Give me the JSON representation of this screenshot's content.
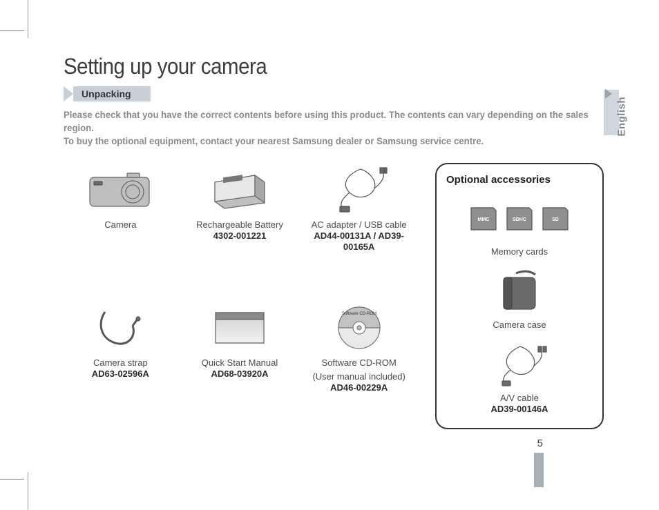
{
  "page": {
    "title": "Setting up your camera",
    "section": "Unpacking",
    "intro_line1": "Please check that you have the correct contents before using this product. The contents can vary depending on the sales region.",
    "intro_line2": "To buy the optional equipment, contact your nearest Samsung dealer or Samsung service centre.",
    "language": "English",
    "number": "5"
  },
  "included": [
    {
      "label": "Camera",
      "part": ""
    },
    {
      "label": "Rechargeable Battery",
      "part": "4302-001221"
    },
    {
      "label": "AC adapter / USB cable",
      "part": "AD44-00131A / AD39-00165A"
    },
    {
      "label": "Camera strap",
      "part": "AD63-02596A"
    },
    {
      "label": "Quick Start Manual",
      "part": "AD68-03920A"
    },
    {
      "label": "Software CD-ROM",
      "sub": "(User manual included)",
      "part": "AD46-00229A"
    }
  ],
  "optional": {
    "heading": "Optional accessories",
    "items": [
      {
        "label": "Memory cards",
        "part": "",
        "cards": [
          "MMC",
          "SDHC",
          "SD"
        ]
      },
      {
        "label": "Camera case",
        "part": ""
      },
      {
        "label": "A/V cable",
        "part": "AD39-00146A"
      }
    ]
  },
  "cd_label": "Software CD-ROM"
}
